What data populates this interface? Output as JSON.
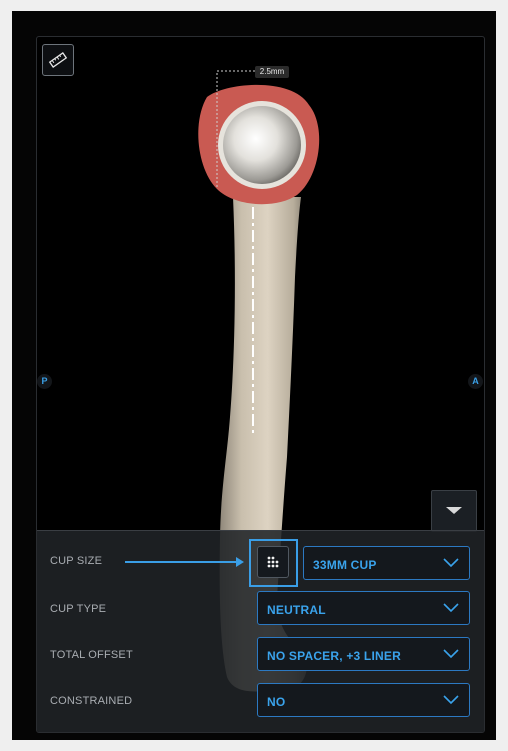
{
  "viewer": {
    "measurement": "2.5mm",
    "left_marker": "P",
    "right_marker": "A",
    "ruler_icon": "ruler-icon",
    "collapse_icon": "caret-down-icon"
  },
  "panel": {
    "grid_icon": "dot-grid-icon",
    "rows": [
      {
        "label": "CUP SIZE",
        "value": "33MM CUP"
      },
      {
        "label": "CUP TYPE",
        "value": "NEUTRAL"
      },
      {
        "label": "TOTAL OFFSET",
        "value": "NO SPACER, +3 LINER"
      },
      {
        "label": "CONSTRAINED",
        "value": "NO"
      }
    ]
  },
  "colors": {
    "accent": "#3a9ee6",
    "bone": "#d9cdb8",
    "tissue_red": "#c95a52"
  }
}
